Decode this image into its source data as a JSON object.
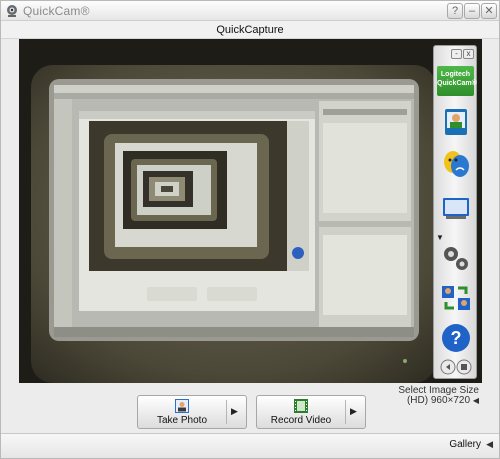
{
  "window": {
    "title": "QuickCam®",
    "help_label": "?",
    "minimize_label": "–",
    "close_label": "✕"
  },
  "section": {
    "title": "QuickCapture"
  },
  "side_panel": {
    "logo_line1": "Logitech",
    "logo_line2": "QuickCam®",
    "mini_minimize": "-",
    "mini_close": "x",
    "tools": [
      {
        "icon": "video-effects-icon"
      },
      {
        "icon": "theater-masks-icon"
      },
      {
        "icon": "screen-icon"
      },
      {
        "icon": "gears-icon"
      },
      {
        "icon": "people-sync-icon"
      },
      {
        "icon": "help-icon"
      },
      {
        "icon": "bottom-buttons-icon"
      }
    ]
  },
  "image_size": {
    "label": "Select Image Size",
    "value": "(HD) 960×720",
    "arrow": "◀"
  },
  "buttons": {
    "take_photo": "Take Photo",
    "record_video": "Record Video",
    "arrow": "▶"
  },
  "gallery": {
    "label": "Gallery",
    "arrow": "◀"
  },
  "colors": {
    "logo_green": "#3aa535",
    "help_blue": "#1f62c8",
    "preview_dark": "#1b1a16"
  }
}
